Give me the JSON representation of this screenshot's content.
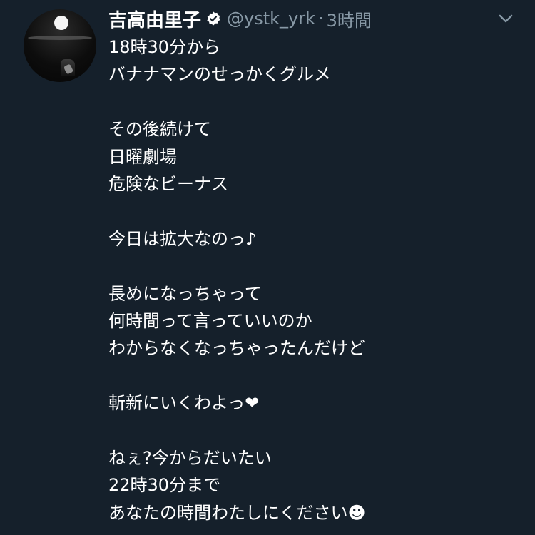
{
  "author": {
    "display_name": "吉高由里子",
    "handle": "@ystk_yrk",
    "separator": "·",
    "timestamp": "3時間",
    "verified": true
  },
  "icons": {
    "avatar": "profile-photo",
    "verified": "verified-badge-icon",
    "more": "chevron-down-icon"
  },
  "colors": {
    "background": "#15202b",
    "text": "#ffffff",
    "secondary_text": "#8899a6"
  },
  "tweet": {
    "lines": [
      "18時30分から",
      "バナナマンのせっかくグルメ",
      "",
      "その後続けて",
      "日曜劇場",
      "危険なビーナス",
      "",
      "今日は拡大なのっ♪",
      "",
      "長めになっちゃって",
      "何時間って言っていいのか",
      "わからなくなっちゃったんだけど",
      "",
      "斬新にいくわよっ❤︎",
      "",
      "ねぇ?今からだいたい",
      "22時30分まで",
      "あなたの時間わたしにください☻"
    ]
  }
}
